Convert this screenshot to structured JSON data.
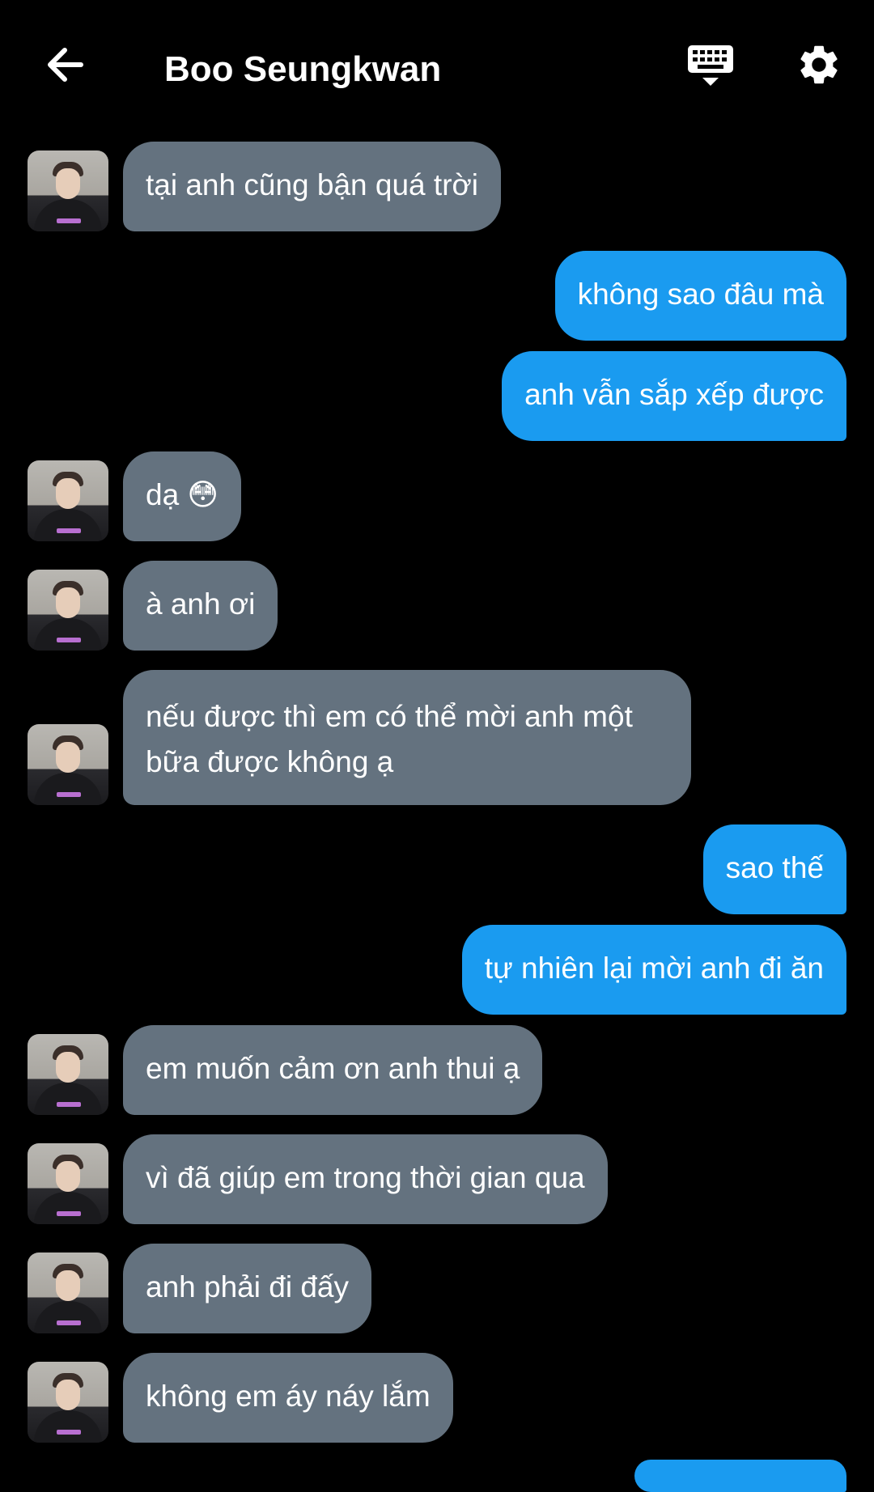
{
  "header": {
    "title": "Boo Seungkwan",
    "back_icon": "arrow-left-icon",
    "keyboard_icon": "keyboard-icon",
    "settings_icon": "gear-icon"
  },
  "colors": {
    "background": "#000000",
    "received_bubble": "#64727f",
    "sent_bubble": "#1a9bf0",
    "text": "#ffffff"
  },
  "messages": [
    {
      "sender": "Boo Seungkwan",
      "direction": "received",
      "text": "tại anh cũng bận quá trời"
    },
    {
      "sender": "me",
      "direction": "sent",
      "text": "không sao đâu mà"
    },
    {
      "sender": "me",
      "direction": "sent",
      "text": "anh vẫn sắp xếp được"
    },
    {
      "sender": "Boo Seungkwan",
      "direction": "received",
      "text": "dạ 😳"
    },
    {
      "sender": "Boo Seungkwan",
      "direction": "received",
      "text": "à anh ơi"
    },
    {
      "sender": "Boo Seungkwan",
      "direction": "received",
      "text": "nếu được thì em có thể mời anh một bữa được không ạ"
    },
    {
      "sender": "me",
      "direction": "sent",
      "text": "sao thế"
    },
    {
      "sender": "me",
      "direction": "sent",
      "text": "tự nhiên lại mời anh đi ăn"
    },
    {
      "sender": "Boo Seungkwan",
      "direction": "received",
      "text": "em muốn cảm ơn anh thui ạ"
    },
    {
      "sender": "Boo Seungkwan",
      "direction": "received",
      "text": "vì đã giúp em trong thời gian qua"
    },
    {
      "sender": "Boo Seungkwan",
      "direction": "received",
      "text": "anh phải đi đấy"
    },
    {
      "sender": "Boo Seungkwan",
      "direction": "received",
      "text": "không em áy náy lắm"
    }
  ]
}
